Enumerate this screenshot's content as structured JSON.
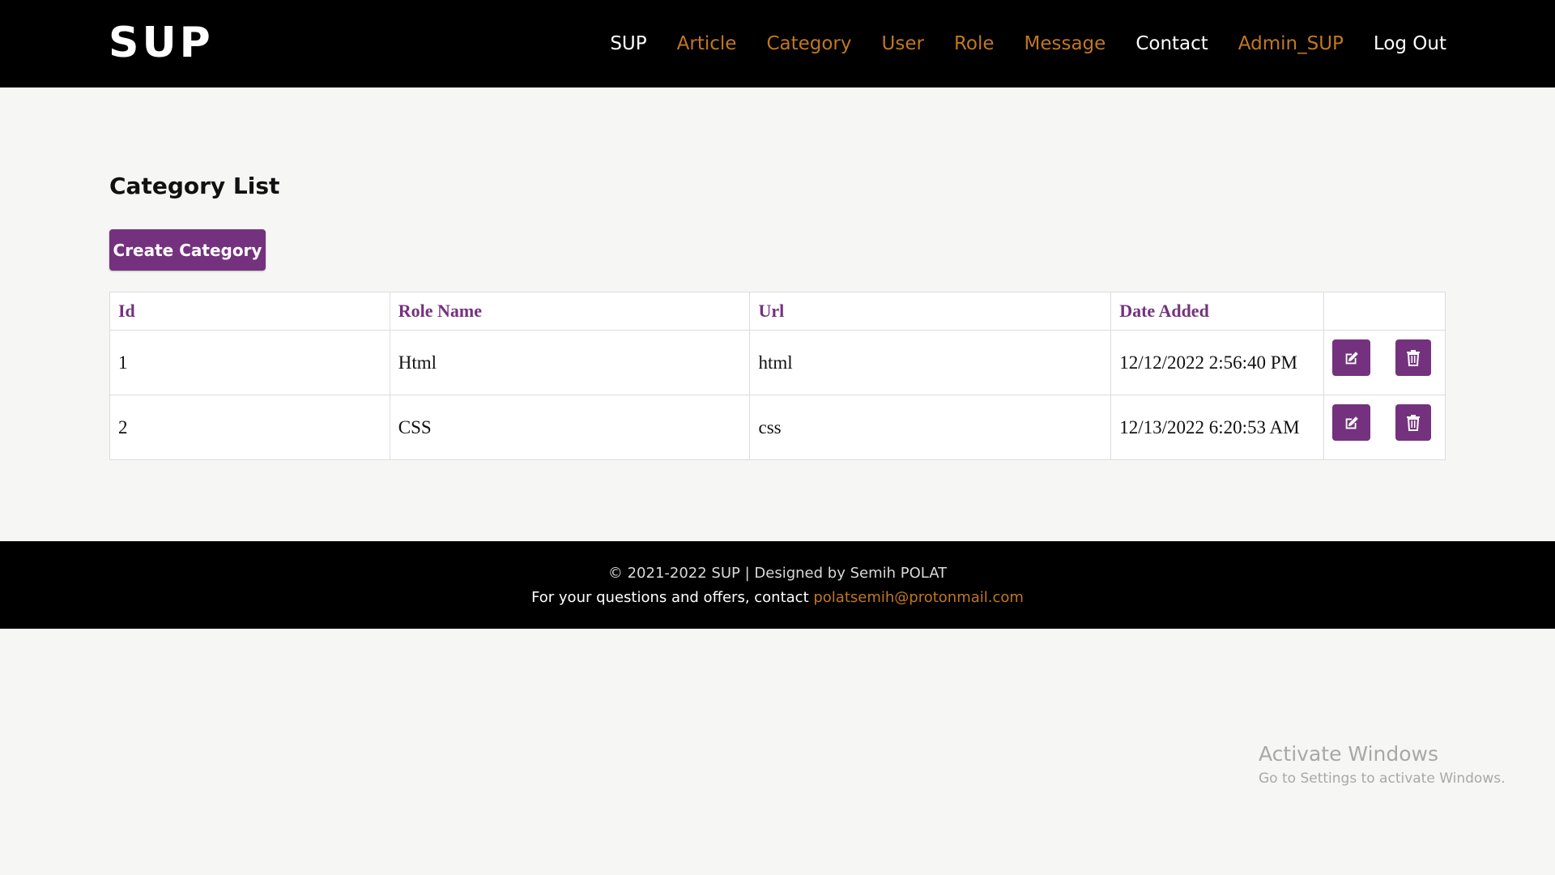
{
  "header": {
    "brand": "SUP",
    "nav": [
      {
        "label": "SUP",
        "style": "white"
      },
      {
        "label": "Article",
        "style": "accent"
      },
      {
        "label": "Category",
        "style": "accent"
      },
      {
        "label": "User",
        "style": "accent"
      },
      {
        "label": "Role",
        "style": "accent"
      },
      {
        "label": "Message",
        "style": "accent"
      },
      {
        "label": "Contact",
        "style": "white"
      },
      {
        "label": "Admin_SUP",
        "style": "accent"
      },
      {
        "label": "Log Out",
        "style": "white"
      }
    ]
  },
  "main": {
    "title": "Category List",
    "create_button_label": "Create Category",
    "table": {
      "columns": [
        "Id",
        "Role Name",
        "Url",
        "Date Added",
        ""
      ],
      "rows": [
        {
          "id": "1",
          "name": "Html",
          "url": "html",
          "date": "12/12/2022 2:56:40 PM"
        },
        {
          "id": "2",
          "name": "CSS",
          "url": "css",
          "date": "12/13/2022 6:20:53 AM"
        }
      ],
      "row_actions": [
        "edit-icon",
        "trash-icon"
      ]
    }
  },
  "footer": {
    "copyright": "© 2021-2022 SUP | Designed by Semih POLAT",
    "contact_text": "For your questions and offers, contact ",
    "contact_email": "polatsemih@protonmail.com"
  },
  "watermark": {
    "title": "Activate Windows",
    "subtitle": "Go to Settings to activate Windows."
  },
  "colors": {
    "accent": "#c1771f",
    "primary": "#74327e",
    "header_bg": "#000000",
    "page_bg": "#f6f7f5"
  }
}
